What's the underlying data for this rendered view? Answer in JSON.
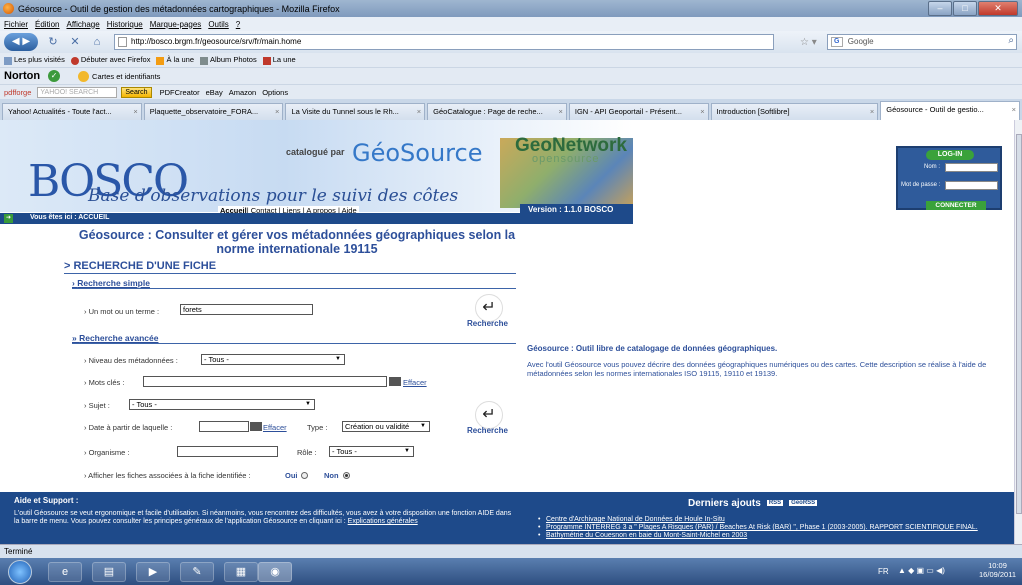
{
  "window": {
    "title": "Géosource - Outil de gestion des métadonnées cartographiques - Mozilla Firefox",
    "buttons": [
      "–",
      "□",
      "✕"
    ]
  },
  "menu": [
    "Fichier",
    "Édition",
    "Affichage",
    "Historique",
    "Marque-pages",
    "Outils",
    "?"
  ],
  "nav": {
    "url": "http://bosco.brgm.fr/geosource/srv/fr/main.home",
    "search_engine": "Google"
  },
  "bookmarks": [
    "Les plus visités",
    "Débuter avec Firefox",
    "À la une",
    "Album Photos",
    "La une"
  ],
  "norton": {
    "logo": "Norton",
    "item": "Cartes et identifiants"
  },
  "yahoo": {
    "brand": "pdfforge",
    "search_placeholder": "YAHOO! SEARCH",
    "search_btn": "Search",
    "items": [
      "PDFCreator",
      "eBay",
      "Amazon",
      "Options"
    ]
  },
  "tabs": [
    {
      "label": "Yahoo! Actualités - Toute l'act...",
      "active": false
    },
    {
      "label": "Plaquette_observatoire_FORA...",
      "active": false
    },
    {
      "label": "La Visite du Tunnel sous le Rh...",
      "active": false
    },
    {
      "label": "GéoCatalogue : Page de reche...",
      "active": false
    },
    {
      "label": "IGN - API Geoportail - Présent...",
      "active": false
    },
    {
      "label": "Introduction [Softlibre]",
      "active": false
    },
    {
      "label": "Géosource - Outil de gestio...",
      "active": true
    }
  ],
  "banner": {
    "logo": "BOSCO",
    "subtitle": "Base d'observations pour le suivi des côtes",
    "catalogue_par": "catalogué par",
    "geosource": "GéoSource",
    "geonetwork": "GeoNetwork",
    "geonetwork_os": "opensource",
    "topnav_active": "Accueil",
    "topnav_rest": "| Contact | Liens | A propos | Aide",
    "version": "Version : 1.1.0 BOSCO"
  },
  "login": {
    "title": "LOG-IN",
    "nom_label": "Nom :",
    "pass_label": "Mot de passe :",
    "button": "CONNECTER"
  },
  "breadcrumb": "Vous êtes ici : ACCUEIL",
  "headline": "Géosource : Consulter et gérer vos métadonnées géographiques selon la norme internationale 19115",
  "search": {
    "section_title": "> RECHERCHE D'UNE FICHE",
    "simple_title": "Recherche simple",
    "mot_label": "Un mot ou un terme :",
    "mot_value": "forets",
    "recherche_label": "Recherche",
    "advanced_title": "Recherche avancée",
    "niveau_label": "Niveau des métadonnées :",
    "niveau_value": "- Tous -",
    "mots_cles_label": "Mots clés :",
    "effacer": "Effacer",
    "sujet_label": "Sujet :",
    "sujet_value": "- Tous -",
    "date_label": "Date à partir de laquelle :",
    "type_label": "Type :",
    "type_value": "Création ou validité",
    "organisme_label": "Organisme :",
    "role_label": "Rôle :",
    "role_value": "- Tous -",
    "associees_label": "Afficher les fiches associées à la fiche identifiée :",
    "oui": "Oui",
    "non": "Non"
  },
  "right": {
    "title": "Géosource : Outil libre de catalogage de données géographiques.",
    "desc": "Avec l'outil Géosource vous pouvez décrire des données géographiques numériques ou des cartes. Cette description se réalise à l'aide de métadonnées selon les normes internationales ISO 19115, 19110 et 19139."
  },
  "footer": {
    "aide_title": "Aide et Support :",
    "aide_text": "L'outil Géosource se veut ergonomique et facile d'utilisation. Si néanmoins, vous rencontrez des difficultés, vous avez à votre disposition une fonction AIDE dans la barre de menu. Vous pouvez consulter les principes généraux de l'application Géosource en cliquant ici :",
    "aide_link": "Explications générales",
    "derniers": "Derniers ajouts",
    "rss": "RSS",
    "georss": "GeoRSS",
    "items": [
      "Centre d'Archivage National de Données de Houle In-Situ",
      "Programme INTERREG 3 a \" Plages A Risques (PAR) / Beaches At Risk (BAR) \", Phase 1 (2003-2005). RAPPORT SCIENTIFIQUE FINAL.",
      "Bathymétrie du Couesnon en baie du Mont-Saint-Michel en 2003"
    ]
  },
  "status": "Terminé",
  "taskbar": {
    "lang": "FR",
    "time": "10:09",
    "date": "16/09/2011"
  }
}
